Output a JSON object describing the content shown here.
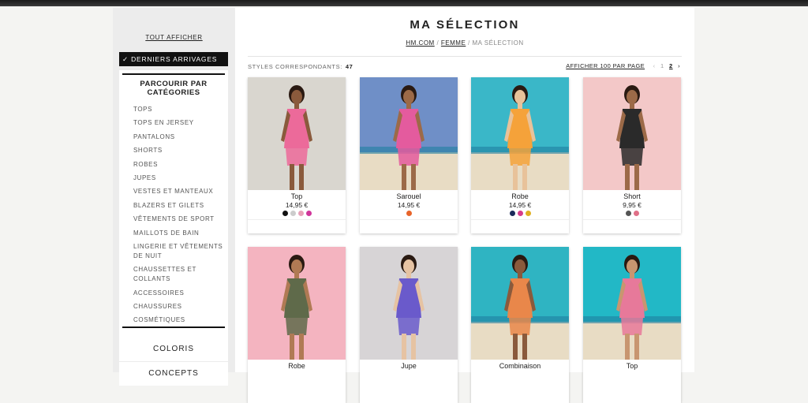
{
  "sidebar": {
    "show_all": "TOUT AFFICHER",
    "new_arrivals": "✓ DERNIERS ARRIVAGES",
    "browse_title": "PARCOURIR PAR\nCATÉGORIES",
    "categories": [
      "TOPS",
      "TOPS EN JERSEY",
      "PANTALONS",
      "SHORTS",
      "ROBES",
      "JUPES",
      "VESTES ET MANTEAUX",
      "BLAZERS ET GILETS",
      "VÊTEMENTS DE SPORT",
      "MAILLOTS DE BAIN",
      "LINGERIE ET VÊTEMENTS DE NUIT",
      "CHAUSSETTES ET COLLANTS",
      "ACCESSOIRES",
      "CHAUSSURES",
      "COSMÉTIQUES"
    ],
    "colors_btn": "COLORIS",
    "concepts_btn": "CONCEPTS"
  },
  "main": {
    "title": "MA SÉLECTION",
    "breadcrumb": [
      "HM.COM",
      "FEMME",
      "MA SÉLECTION"
    ],
    "styles_label": "STYLES CORRESPONDANTS:",
    "styles_count": "47",
    "per_page": "AFFICHER 100 PAR PAGE",
    "prev_arrow": "‹",
    "pages": [
      "1",
      "2"
    ],
    "current_page": "2",
    "next_arrow": "›"
  },
  "products": [
    {
      "name": "Top",
      "price": "14,95 €",
      "swatches": [
        "#111111",
        "#cccccc",
        "#e8a0b8",
        "#d0359a"
      ],
      "bg": "#d9d6cf",
      "outfit": "#ec6a9a",
      "skin": "#8a5a3c"
    },
    {
      "name": "Sarouel",
      "price": "14,95 €",
      "swatches": [
        "#e8642a"
      ],
      "bg": "#6f8fc7",
      "outfit": "#e45b9e",
      "skin": "#9c6a48"
    },
    {
      "name": "Robe",
      "price": "14,95 €",
      "swatches": [
        "#1a2a5a",
        "#d63b8a",
        "#e0b020"
      ],
      "bg": "#3ab7c8",
      "outfit": "#f5a23a",
      "skin": "#e8c29a"
    },
    {
      "name": "Short",
      "price": "9,95 €",
      "swatches": [
        "#555555",
        "#e07088"
      ],
      "bg": "#f3c8c8",
      "outfit": "#2a2a2a",
      "skin": "#9c6a48"
    },
    {
      "name": "Robe",
      "price": "",
      "swatches": [],
      "bg": "#f4b4c0",
      "outfit": "#5f6a4a",
      "skin": "#b07a54"
    },
    {
      "name": "Jupe",
      "price": "",
      "swatches": [],
      "bg": "#d7d4d6",
      "outfit": "#6a5acb",
      "skin": "#e6c3a3"
    },
    {
      "name": "Combinaison",
      "price": "",
      "swatches": [],
      "bg": "#2fb4c2",
      "outfit": "#e9874a",
      "skin": "#8a5a3c"
    },
    {
      "name": "Top",
      "price": "",
      "swatches": [],
      "bg": "#22b8c6",
      "outfit": "#e7799a",
      "skin": "#c89670"
    }
  ]
}
